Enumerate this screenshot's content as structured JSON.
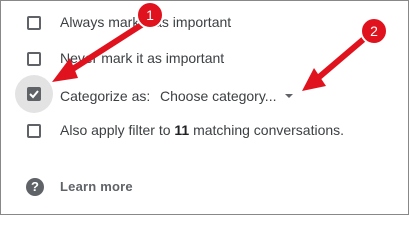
{
  "options": {
    "always_important": "Always mark it as important",
    "never_important": "Never mark it as important",
    "categorize_label": "Categorize as:",
    "category_placeholder": "Choose category...",
    "apply_prefix": "Also apply filter to ",
    "apply_count": "11",
    "apply_suffix": " matching conversations."
  },
  "states": {
    "always_important": false,
    "never_important": false,
    "categorize": true,
    "apply_existing": false
  },
  "help": {
    "icon": "help-icon",
    "learn_more": "Learn more"
  },
  "annotations": {
    "marker_1": "1",
    "marker_2": "2",
    "color": "#e0121e"
  }
}
